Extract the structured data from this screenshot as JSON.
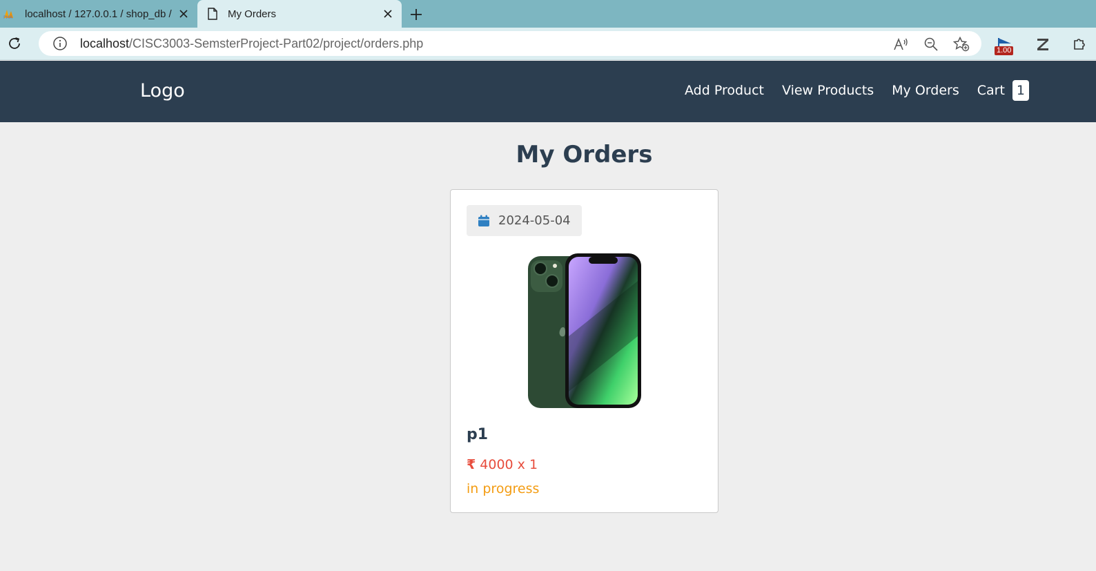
{
  "browser": {
    "tabs": [
      {
        "title": "localhost / 127.0.0.1 / shop_db /",
        "favicon": "phpmyadmin-icon"
      },
      {
        "title": "My Orders",
        "favicon": "page-icon"
      }
    ],
    "url_host": "localhost",
    "url_path": "/CISC3003-SemsterProject-Part02/project/orders.php",
    "extension_badge": "1.00"
  },
  "header": {
    "logo": "Logo",
    "nav": {
      "add_product": "Add Product",
      "view_products": "View Products",
      "my_orders": "My Orders",
      "cart": "Cart",
      "cart_count": "1"
    }
  },
  "main": {
    "title": "My Orders",
    "orders": [
      {
        "date": "2024-05-04",
        "product_name": "p1",
        "currency": "₹",
        "price_qty": " 4000 x 1",
        "status": "in progress"
      }
    ]
  },
  "colors": {
    "header_bg": "#2c3e50",
    "page_bg": "#eeeeee",
    "price": "#e74c3c",
    "status": "#f39c12",
    "calendar_icon": "#2f80c2"
  }
}
